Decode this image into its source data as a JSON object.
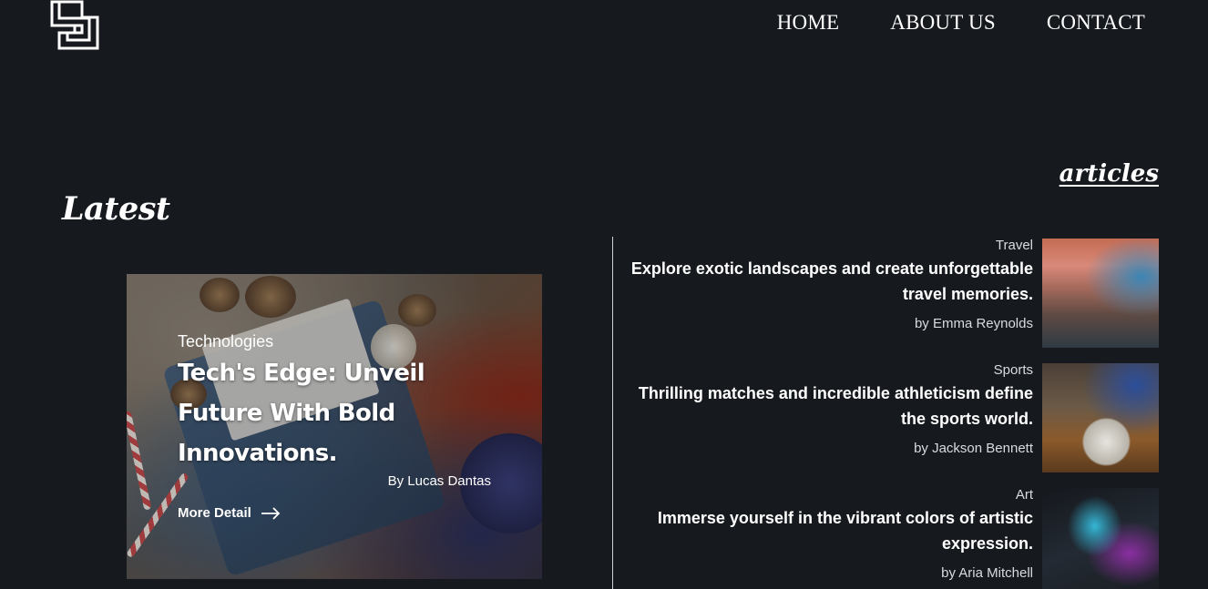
{
  "nav": {
    "items": [
      {
        "label": "HOME"
      },
      {
        "label": "ABOUT US"
      },
      {
        "label": "CONTACT"
      }
    ]
  },
  "sections": {
    "latest_title": "Latest",
    "articles_title": "articles"
  },
  "feature": {
    "category": "Technologies",
    "headline": "Tech's Edge: Unveil Future With Bold Innovations.",
    "author": "By Lucas Dantas",
    "more_label": "More Detail"
  },
  "articles": [
    {
      "category": "Travel",
      "title": "Explore exotic landscapes and create unforgettable travel memories.",
      "author": "by Emma Reynolds"
    },
    {
      "category": "Sports",
      "title": "Thrilling matches and incredible athleticism define the sports world.",
      "author": "by Jackson Bennett"
    },
    {
      "category": "Art",
      "title": "Immerse yourself in the vibrant colors of artistic expression.",
      "author": "by Aria Mitchell"
    }
  ],
  "colors": {
    "background": "#161a1f",
    "text": "#ffffff",
    "muted": "#d8dbe0",
    "divider": "#cfd2d6"
  }
}
